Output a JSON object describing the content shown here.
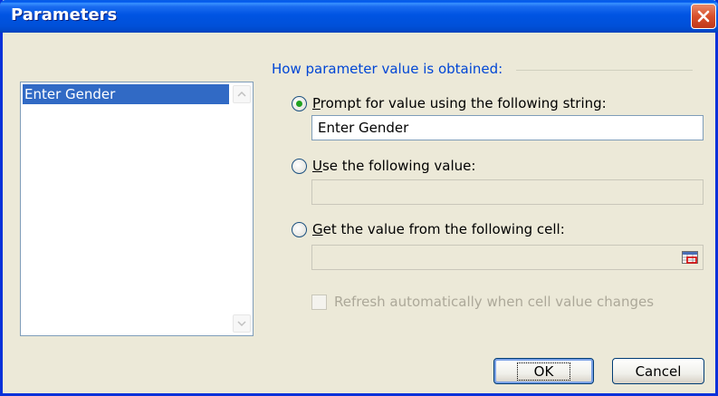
{
  "window": {
    "title": "Parameters"
  },
  "parameters_list": {
    "items": [
      "Enter Gender"
    ]
  },
  "group": {
    "label": "How parameter value is obtained:"
  },
  "options": {
    "prompt": {
      "accel": "P",
      "rest": "rompt for value using the following string:",
      "selected": true,
      "value": "Enter Gender"
    },
    "use_value": {
      "accel": "U",
      "rest": "se the following value:",
      "selected": false,
      "value": ""
    },
    "from_cell": {
      "accel": "G",
      "rest": "et the value from the following cell:",
      "selected": false,
      "value": ""
    }
  },
  "refresh_checkbox": {
    "label": "Refresh automatically when cell value changes",
    "checked": false,
    "enabled": false
  },
  "buttons": {
    "ok": "OK",
    "cancel": "Cancel"
  },
  "colors": {
    "titlebar": "#0054e3",
    "selection": "#316ac5",
    "group_label": "#0046d5",
    "radio_dot": "#21a121"
  }
}
